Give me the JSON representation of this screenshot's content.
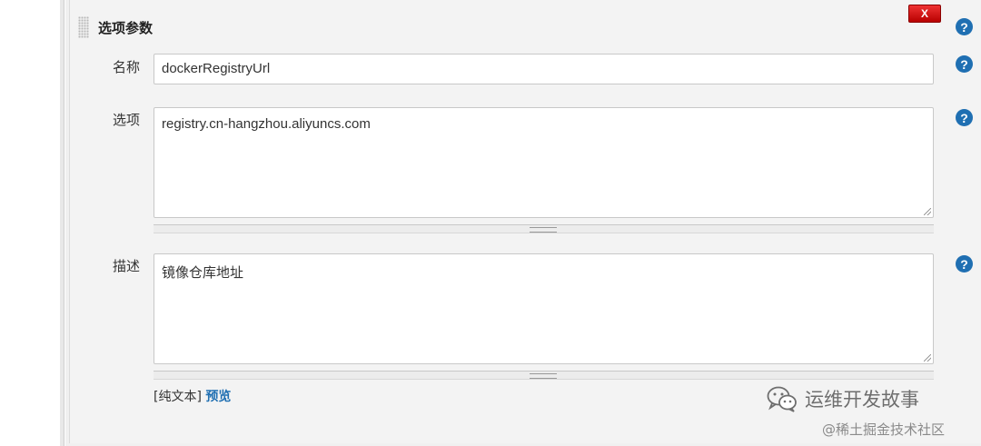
{
  "section": {
    "title": "选项参数",
    "delete_label": "X",
    "help_label": "?"
  },
  "fields": {
    "name": {
      "label": "名称",
      "value": "dockerRegistryUrl"
    },
    "choices": {
      "label": "选项",
      "value": "registry.cn-hangzhou.aliyuncs.com"
    },
    "description": {
      "label": "描述",
      "value": "镜像仓库地址"
    }
  },
  "format": {
    "plain_text": "[纯文本]",
    "preview": "预览"
  },
  "watermark": {
    "brand": "运维开发故事",
    "sub": "@稀土掘金技术社区"
  },
  "colors": {
    "help_blue": "#1f6fb2",
    "delete_red": "#cc0000"
  }
}
